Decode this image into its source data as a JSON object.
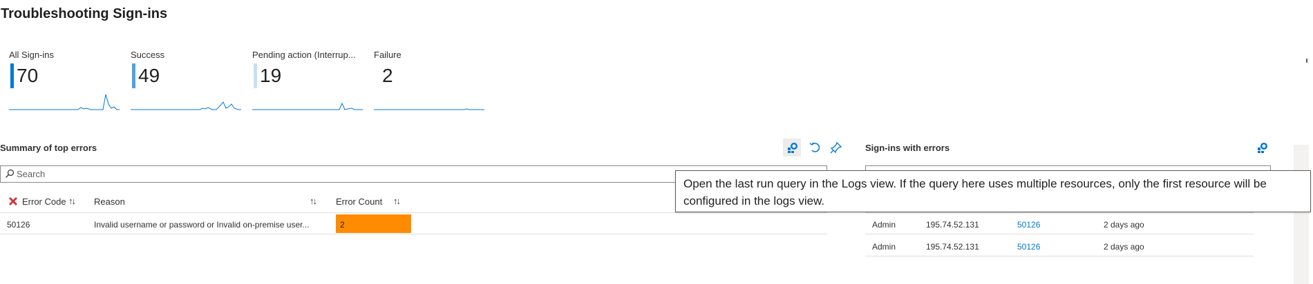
{
  "page": {
    "title": "Troubleshooting Sign-ins"
  },
  "tiles": [
    {
      "label": "All Sign-ins",
      "value": "70",
      "bar_color": "#0078d4"
    },
    {
      "label": "Success",
      "value": "49",
      "bar_color": "#4fa3e3"
    },
    {
      "label": "Pending action (Interrup...",
      "value": "19",
      "bar_color": "#c7e0f4"
    },
    {
      "label": "Failure",
      "value": "2",
      "bar_color": "#ffffff"
    }
  ],
  "sparkline_color": "#0078d4",
  "summary": {
    "title": "Summary of top errors",
    "search_placeholder": "Search",
    "columns": {
      "error_code": "Error Code",
      "reason": "Reason",
      "error_count": "Error Count"
    },
    "rows": [
      {
        "error_code": "50126",
        "reason": "Invalid username or password or Invalid on-premise user...",
        "error_count": "2",
        "error_count_fraction": 0.23
      }
    ],
    "bar_color": "#ff8c00",
    "sort_glyph": "↑↓"
  },
  "errors_panel": {
    "title": "Sign-ins with errors",
    "rows": [
      {
        "user": "Admin",
        "ip": "195.74.52.131",
        "code": "50126",
        "time": "2 days ago"
      },
      {
        "user": "Admin",
        "ip": "195.74.52.131",
        "code": "50126",
        "time": "2 days ago"
      }
    ]
  },
  "tooltip": {
    "text": "Open the last run query in the Logs view. If the query here uses multiple resources, only the first resource will be configured in the logs view."
  },
  "colors": {
    "accent": "#0078d4",
    "error_icon": "#d13438"
  }
}
